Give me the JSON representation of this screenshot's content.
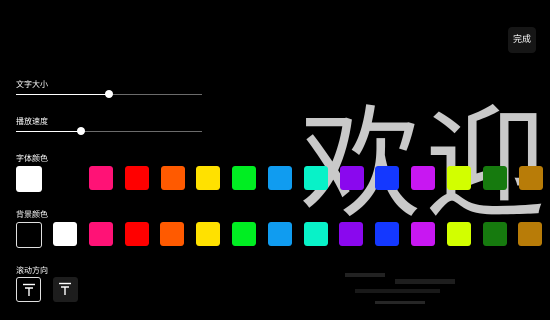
{
  "header": {
    "done_label": "完成"
  },
  "preview": {
    "text": "欢迎"
  },
  "text_size": {
    "label": "文字大小",
    "value_fraction": 0.5
  },
  "play_speed": {
    "label": "播放速度",
    "value_fraction": 0.35
  },
  "font_color": {
    "label": "字体颜色",
    "selected": "#ffffff",
    "options": [
      "#ff1276",
      "#ff0000",
      "#ff5a00",
      "#ffe100",
      "#00ee22",
      "#109cf0",
      "#08f2c8",
      "#8a08ee",
      "#1438ff",
      "#c817f2",
      "#d2ff00",
      "#167a0e",
      "#b87c08"
    ]
  },
  "bg_color": {
    "label": "背景颜色",
    "selected": "#000000",
    "options": [
      "#ffffff",
      "#ff1276",
      "#ff0000",
      "#ff5a00",
      "#ffe100",
      "#00ee22",
      "#109cf0",
      "#08f2c8",
      "#8a08ee",
      "#1438ff",
      "#c817f2",
      "#d2ff00",
      "#167a0e",
      "#b87c08"
    ]
  },
  "scroll_direction": {
    "label": "滚动方向",
    "options": [
      "vertical-text-down-icon",
      "vertical-text-up-icon"
    ],
    "selected_index": 0
  }
}
